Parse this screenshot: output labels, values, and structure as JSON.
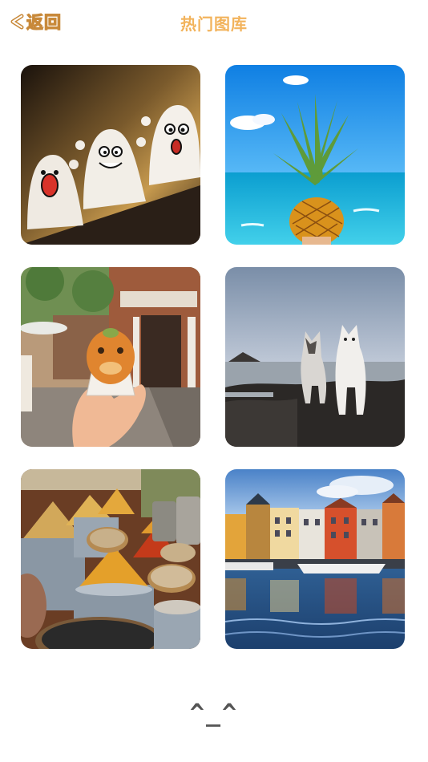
{
  "header": {
    "back_label": "返回",
    "title": "热门图库"
  },
  "gallery": {
    "images": [
      {
        "subject": "ghost-figurines"
      },
      {
        "subject": "pineapple-ocean"
      },
      {
        "subject": "pastry-hand-street"
      },
      {
        "subject": "two-dogs-rocks-sunset"
      },
      {
        "subject": "spice-market"
      },
      {
        "subject": "colorful-harbor-houses"
      }
    ]
  },
  "footer": {
    "end_face": "^_^"
  },
  "colors": {
    "title": "#f2b35c",
    "back_outline": "#c8893a"
  }
}
